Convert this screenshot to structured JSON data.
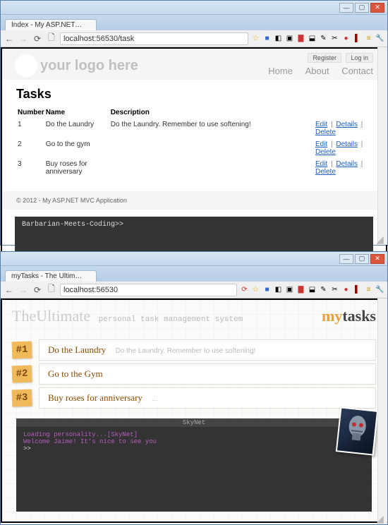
{
  "window1": {
    "tab_title": "Index - My ASP.NET MVC ...",
    "url": "localhost:56530/task",
    "logo_text": "your logo here",
    "auth": {
      "register": "Register",
      "login": "Log in"
    },
    "nav": {
      "home": "Home",
      "about": "About",
      "contact": "Contact"
    },
    "page_title": "Tasks",
    "columns": {
      "number": "Number",
      "name": "Name",
      "description": "Description"
    },
    "tasks": [
      {
        "num": "1",
        "name": "Do the Laundry",
        "desc": "Do the Laundry. Remember to use softening!"
      },
      {
        "num": "2",
        "name": "Go to the gym",
        "desc": ""
      },
      {
        "num": "3",
        "name": "Buy roses for anniversary",
        "desc": ""
      }
    ],
    "row_actions": {
      "edit": "Edit",
      "details": "Details",
      "delete": "Delete"
    },
    "footer": "© 2012 - My ASP.NET MVC Application",
    "terminal_prompt": "Barbarian-Meets-Coding>>"
  },
  "window2": {
    "tab_title": "myTasks - The Ultimate Pe...",
    "url": "localhost:56530",
    "brand_left": "TheUltimate",
    "brand_sub": "personal task management system",
    "brand_right_my": "my",
    "brand_right_tasks": "tasks",
    "tasks": [
      {
        "badge": "#1",
        "title": "Do the Laundry",
        "desc": "Do the Laundry. Remember to use softening!"
      },
      {
        "badge": "#2",
        "title": "Go to the Gym",
        "desc": ""
      },
      {
        "badge": "#3",
        "title": "Buy roses for anniversary",
        "desc": "..."
      }
    ],
    "terminal": {
      "title": "SkyNet",
      "line1": "Loading personality...[SkyNet]",
      "line2": "Welcome Jaime! It's nice to see you",
      "prompt": ">>"
    }
  }
}
